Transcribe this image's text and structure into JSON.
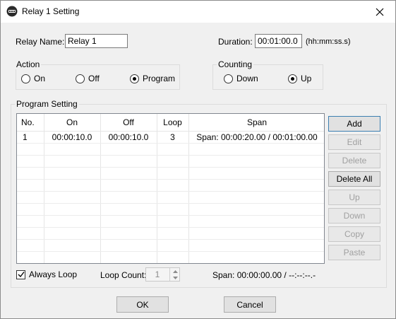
{
  "window": {
    "title": "Relay 1 Setting",
    "close_glyph": "✕"
  },
  "relay_name": {
    "label": "Relay Name:",
    "value": "Relay 1"
  },
  "duration": {
    "label": "Duration:",
    "value": "00:01:00.0",
    "format_hint": "(hh:mm:ss.s)"
  },
  "action": {
    "title": "Action",
    "options": [
      {
        "label": "On",
        "checked": false
      },
      {
        "label": "Off",
        "checked": false
      },
      {
        "label": "Program",
        "checked": true
      }
    ]
  },
  "counting": {
    "title": "Counting",
    "options": [
      {
        "label": "Down",
        "checked": false
      },
      {
        "label": "Up",
        "checked": true
      }
    ]
  },
  "program_setting": {
    "title": "Program Setting",
    "columns": [
      "No.",
      "On",
      "Off",
      "Loop",
      "Span"
    ],
    "rows": [
      {
        "no": "1",
        "on": "00:00:10.0",
        "off": "00:00:10.0",
        "loop": "3",
        "span": "Span: 00:00:20.00 / 00:01:00.00"
      }
    ]
  },
  "side_buttons": {
    "add": "Add",
    "edit": "Edit",
    "delete": "Delete",
    "delete_all": "Delete All",
    "up": "Up",
    "down": "Down",
    "copy": "Copy",
    "paste": "Paste"
  },
  "always_loop": {
    "label": "Always Loop",
    "checked": true
  },
  "loop_count": {
    "label": "Loop Count:",
    "value": "1"
  },
  "total_span": "Span: 00:00:00.00 / --:--:--.-",
  "footer": {
    "ok": "OK",
    "cancel": "Cancel"
  },
  "icons": {
    "app": "relay-app-icon",
    "close": "close-icon",
    "check": "checkmark-icon",
    "spin_up": "spin-up-icon",
    "spin_down": "spin-down-icon"
  }
}
